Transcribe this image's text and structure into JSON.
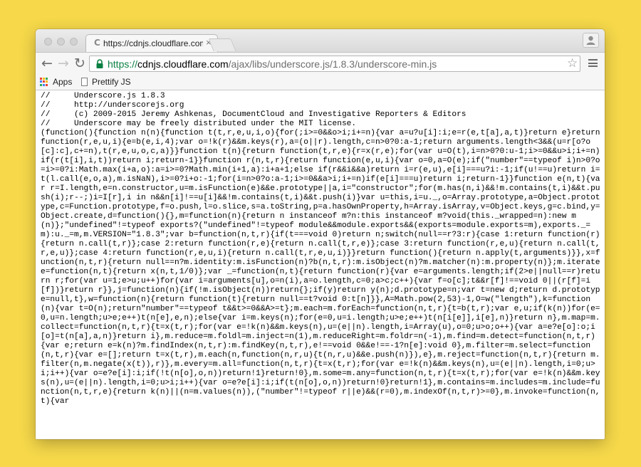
{
  "browser": {
    "tab": {
      "title": "https://cdnjs.cloudflare.com",
      "favicon": "C",
      "close_glyph": "×"
    },
    "toolbar": {
      "back_icon": "←",
      "forward_icon": "→",
      "reload_icon": "↻",
      "bookmark_star_icon": "☆"
    },
    "address_bar": {
      "scheme": "https://",
      "host": "cdnjs.cloudflare.com",
      "path": "/ajax/libs/underscore.js/1.8.3/underscore-min.js"
    },
    "bookmarks": [
      {
        "label": "Apps",
        "icon": "apps-grid-icon"
      },
      {
        "label": "Prettify JS",
        "icon": "page-icon"
      }
    ],
    "colors": {
      "secure_green": "#0b8043",
      "background": "#f6d84a"
    }
  },
  "page": {
    "code": "//     Underscore.js 1.8.3\n//     http://underscorejs.org\n//     (c) 2009-2015 Jeremy Ashkenas, DocumentCloud and Investigative Reporters & Editors\n//     Underscore may be freely distributed under the MIT license.\n(function(){function n(n){function t(t,r,e,u,i,o){for(;i>=0&&o>i;i+=n){var a=u?u[i]:i;e=r(e,t[a],a,t)}return e}return function(r,e,u,i){e=b(e,i,4);var o=!k(r)&&m.keys(r),a=(o||r).length,c=n>0?0:a-1;return arguments.length<3&&(u=r[o?o[c]:c],c+=n),t(r,e,u,o,c,a)}}function t(n){return function(t,r,e){r=x(r,e);for(var u=O(t),i=n>0?0:u-1;i>=0&&u>i;i+=n)if(r(t[i],i,t))return i;return-1}}function r(n,t,r){return function(e,u,i){var o=0,a=O(e);if(\"number\"==typeof i)n>0?o=i>=0?i:Math.max(i+a,o):a=i>=0?Math.min(i+1,a):i+a+1;else if(r&&i&&a)return i=r(e,u),e[i]===u?i:-1;if(u!==u)return i=t(l.call(e,o,a),m.isNaN),i>=0?i+o:-1;for(i=n>0?o:a-1;i>=0&&a>i;i+=n)if(e[i]===u)return i;return-1}}function e(n,t){var r=I.length,e=n.constructor,u=m.isFunction(e)&&e.prototype||a,i=\"constructor\";for(m.has(n,i)&&!m.contains(t,i)&&t.push(i);r--;)i=I[r],i in n&&n[i]!==u[i]&&!m.contains(t,i)&&t.push(i)}var u=this,i=u._,o=Array.prototype,a=Object.prototype,c=Function.prototype,f=o.push,l=o.slice,s=a.toString,p=a.hasOwnProperty,h=Array.isArray,v=Object.keys,g=c.bind,y=Object.create,d=function(){},m=function(n){return n instanceof m?n:this instanceof m?void(this._wrapped=n):new m(n)};\"undefined\"!=typeof exports?(\"undefined\"!=typeof module&&module.exports&&(exports=module.exports=m),exports._=m):u._=m,m.VERSION=\"1.8.3\";var b=function(n,t,r){if(t===void 0)return n;switch(null==r?3:r){case 1:return function(r){return n.call(t,r)};case 2:return function(r,e){return n.call(t,r,e)};case 3:return function(r,e,u){return n.call(t,r,e,u)};case 4:return function(r,e,u,i){return n.call(t,r,e,u,i)}}return function(){return n.apply(t,arguments)}},x=function(n,t,r){return null==n?m.identity:m.isFunction(n)?b(n,t,r):m.isObject(n)?m.matcher(n):m.property(n)};m.iteratee=function(n,t){return x(n,t,1/0)};var _=function(n,t){return function(r){var e=arguments.length;if(2>e||null==r)return r;for(var u=1;e>u;u++)for(var i=arguments[u],o=n(i),a=o.length,c=0;a>c;c++){var f=o[c];t&&r[f]!==void 0||(r[f]=i[f])}return r}},j=function(n){if(!m.isObject(n))return{};if(y)return y(n);d.prototype=n;var t=new d;return d.prototype=null,t},w=function(n){return function(t){return null==t?void 0:t[n]}},A=Math.pow(2,53)-1,O=w(\"length\"),k=function(n){var t=O(n);return\"number\"==typeof t&&t>=0&&A>=t};m.each=m.forEach=function(n,t,r){t=b(t,r);var e,u;if(k(n))for(e=0,u=n.length;u>e;e++)t(n[e],e,n);else{var i=m.keys(n);for(e=0,u=i.length;u>e;e++)t(n[i[e]],i[e],n)}return n},m.map=m.collect=function(n,t,r){t=x(t,r);for(var e=!k(n)&&m.keys(n),u=(e||n).length,i=Array(u),o=0;u>o;o++){var a=e?e[o]:o;i[o]=t(n[a],a,n)}return i},m.reduce=m.foldl=m.inject=n(1),m.reduceRight=m.foldr=n(-1),m.find=m.detect=function(n,t,r){var e;return e=k(n)?m.findIndex(n,t,r):m.findKey(n,t,r),e!==void 0&&e!==-1?n[e]:void 0},m.filter=m.select=function(n,t,r){var e=[];return t=x(t,r),m.each(n,function(n,r,u){t(n,r,u)&&e.push(n)}),e},m.reject=function(n,t,r){return m.filter(n,m.negate(x(t)),r)},m.every=m.all=function(n,t,r){t=x(t,r);for(var e=!k(n)&&m.keys(n),u=(e||n).length,i=0;u>i;i++){var o=e?e[i]:i;if(!t(n[o],o,n))return!1}return!0},m.some=m.any=function(n,t,r){t=x(t,r);for(var e=!k(n)&&m.keys(n),u=(e||n).length,i=0;u>i;i++){var o=e?e[i]:i;if(t(n[o],o,n))return!0}return!1},m.contains=m.includes=m.include=function(n,t,r,e){return k(n)||(n=m.values(n)),(\"number\"!=typeof r||e)&&(r=0),m.indexOf(n,t,r)>=0},m.invoke=function(n,t){var"
  }
}
